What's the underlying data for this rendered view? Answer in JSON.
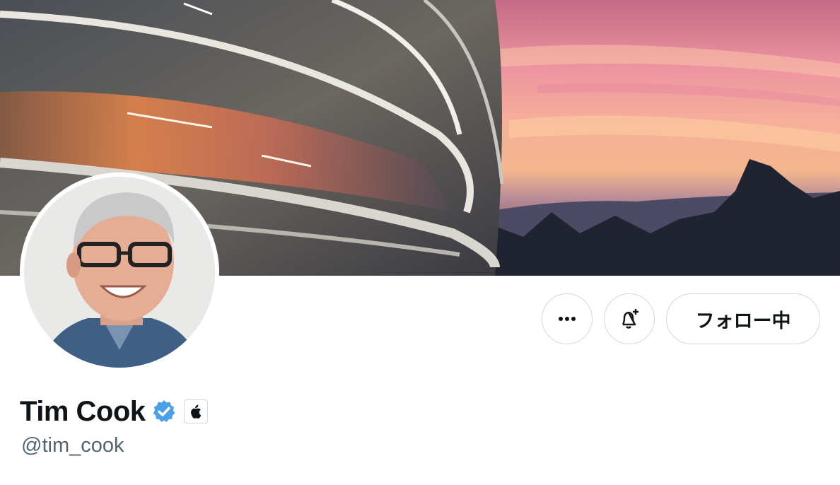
{
  "profile": {
    "display_name": "Tim Cook",
    "handle": "@tim_cook",
    "verified": true,
    "affiliate_badge_icon": "apple-logo-icon"
  },
  "actions": {
    "more_icon": "more-horizontal-icon",
    "notify_icon": "bell-plus-icon",
    "follow_label": "フォロー中"
  },
  "colors": {
    "verified_blue": "#4a9fe8",
    "text_primary": "#0f1419",
    "text_secondary": "#536471",
    "button_border": "#cfd9de"
  }
}
